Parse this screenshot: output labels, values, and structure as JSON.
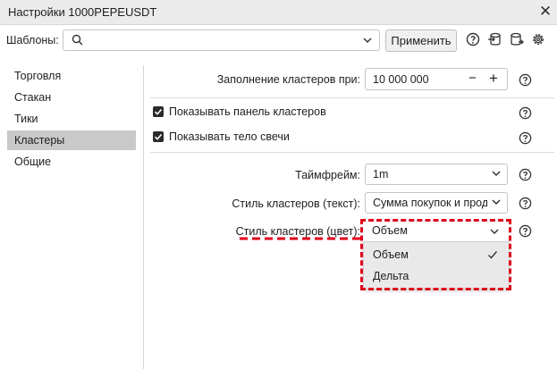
{
  "window": {
    "title": "Настройки 1000PEPEUSDT",
    "close_glyph": "✕"
  },
  "templates": {
    "label": "Шаблоны:",
    "value": "",
    "apply_label": "Применить"
  },
  "toolbar_icons": [
    "help-icon",
    "import-icon",
    "export-icon",
    "settings-gear-icon"
  ],
  "sidebar": {
    "items": [
      {
        "label": "Торговля",
        "active": false
      },
      {
        "label": "Стакан",
        "active": false
      },
      {
        "label": "Тики",
        "active": false
      },
      {
        "label": "Кластеры",
        "active": true
      },
      {
        "label": "Общие",
        "active": false
      }
    ]
  },
  "fill": {
    "label": "Заполнение кластеров при:",
    "value": "10 000 000",
    "minus": "−",
    "plus": "+"
  },
  "checks": {
    "show_panel": {
      "label": "Показывать панель кластеров",
      "checked": true
    },
    "show_body": {
      "label": "Показывать тело свечи",
      "checked": true
    }
  },
  "timeframe": {
    "label": "Таймфрейм:",
    "value": "1m"
  },
  "style_text": {
    "label": "Стиль кластеров (текст):",
    "value": "Сумма покупок и прод"
  },
  "style_color": {
    "label": "Стиль кластеров (цвет):",
    "value": "Объем",
    "options": [
      {
        "label": "Объем",
        "selected": true
      },
      {
        "label": "Дельта",
        "selected": false
      }
    ]
  },
  "colors": {
    "highlight": "#e0001b",
    "active_nav": "#c9c9c9",
    "dropdown_accent": "#7a5fc7"
  }
}
